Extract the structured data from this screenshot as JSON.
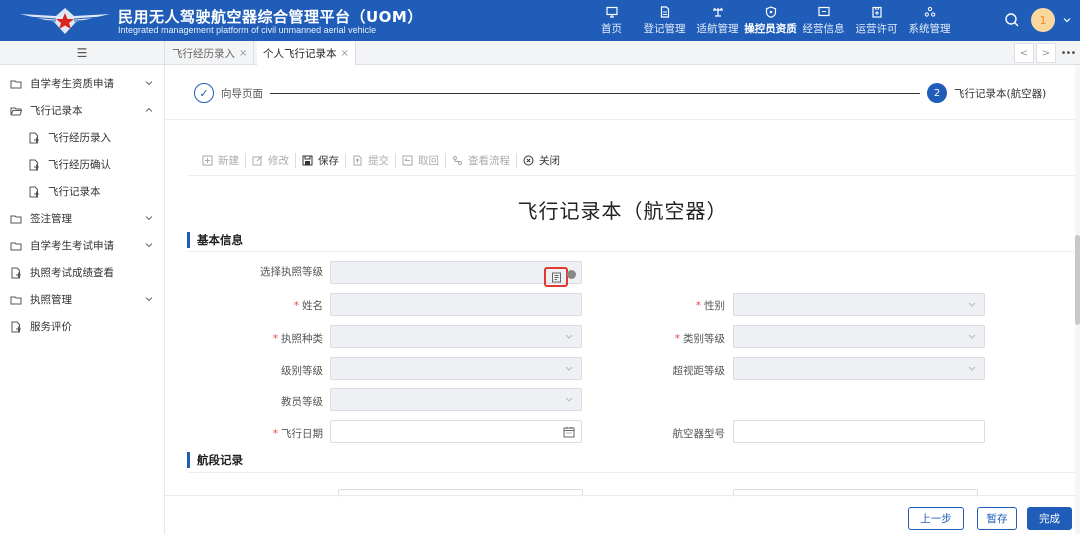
{
  "header": {
    "title": "民用无人驾驶航空器综合管理平台（UOM）",
    "subtitle": "Integrated management platform of civil unmanned aerial vehicle",
    "nav": [
      {
        "label": "首页",
        "icon": "monitor-icon"
      },
      {
        "label": "登记管理",
        "icon": "document-icon"
      },
      {
        "label": "适航管理",
        "icon": "plane-icon"
      },
      {
        "label": "操控员资质",
        "icon": "shield-icon",
        "active": true
      },
      {
        "label": "经营信息",
        "icon": "screen-icon"
      },
      {
        "label": "运营许可",
        "icon": "clipboard-icon"
      },
      {
        "label": "系统管理",
        "icon": "cluster-icon"
      }
    ],
    "avatar": "1",
    "colors": {
      "bar": "#1f5db9",
      "required": "#e34d4d",
      "highlight": "#e03a2f"
    }
  },
  "tabs": {
    "menu_icon": "☰",
    "items": [
      {
        "label": "飞行经历录入",
        "close": "×"
      },
      {
        "label": "个人飞行记录本",
        "close": "×",
        "active": true
      }
    ],
    "prev": "<",
    "next": ">",
    "more": "•••"
  },
  "sidebar": {
    "items": [
      {
        "label": "自学考生资质申请",
        "icon": "folder-icon",
        "chevron": "down"
      },
      {
        "label": "飞行记录本",
        "icon": "folder-open-icon",
        "chevron": "up"
      },
      {
        "label": "飞行经历录入",
        "icon": "file-icon",
        "sub": true
      },
      {
        "label": "飞行经历确认",
        "icon": "file-icon",
        "sub": true
      },
      {
        "label": "飞行记录本",
        "icon": "file-icon",
        "sub": true
      },
      {
        "label": "签注管理",
        "icon": "folder-icon",
        "chevron": "down"
      },
      {
        "label": "自学考生考试申请",
        "icon": "folder-icon",
        "chevron": "down"
      },
      {
        "label": "执照考试成绩查看",
        "icon": "file-icon"
      },
      {
        "label": "执照管理",
        "icon": "folder-icon",
        "chevron": "down"
      },
      {
        "label": "服务评价",
        "icon": "file-icon"
      }
    ]
  },
  "steps": {
    "step1": {
      "label": "向导页面",
      "mark": "✓"
    },
    "step2": {
      "number": "2",
      "label": "飞行记录本(航空器)"
    }
  },
  "toolbar": {
    "new": "新建",
    "edit": "修改",
    "save": "保存",
    "submit": "提交",
    "withdraw": "取回",
    "flow": "查看流程",
    "close": "关闭"
  },
  "form": {
    "title": "飞行记录本（航空器）",
    "section_basic": "基本信息",
    "section_segments": "航段记录",
    "license_level": "选择执照等级",
    "name": "姓名",
    "gender": "性别",
    "license_type": "执照种类",
    "class_level": "类别等级",
    "grade_level": "级别等级",
    "bvlos_level": "超视距等级",
    "instructor_level": "教员等级",
    "flight_date": "飞行日期",
    "aircraft_model": "航空器型号",
    "required_mark": "*"
  },
  "footer": {
    "prev": "上一步",
    "draft": "暂存",
    "finish": "完成"
  }
}
